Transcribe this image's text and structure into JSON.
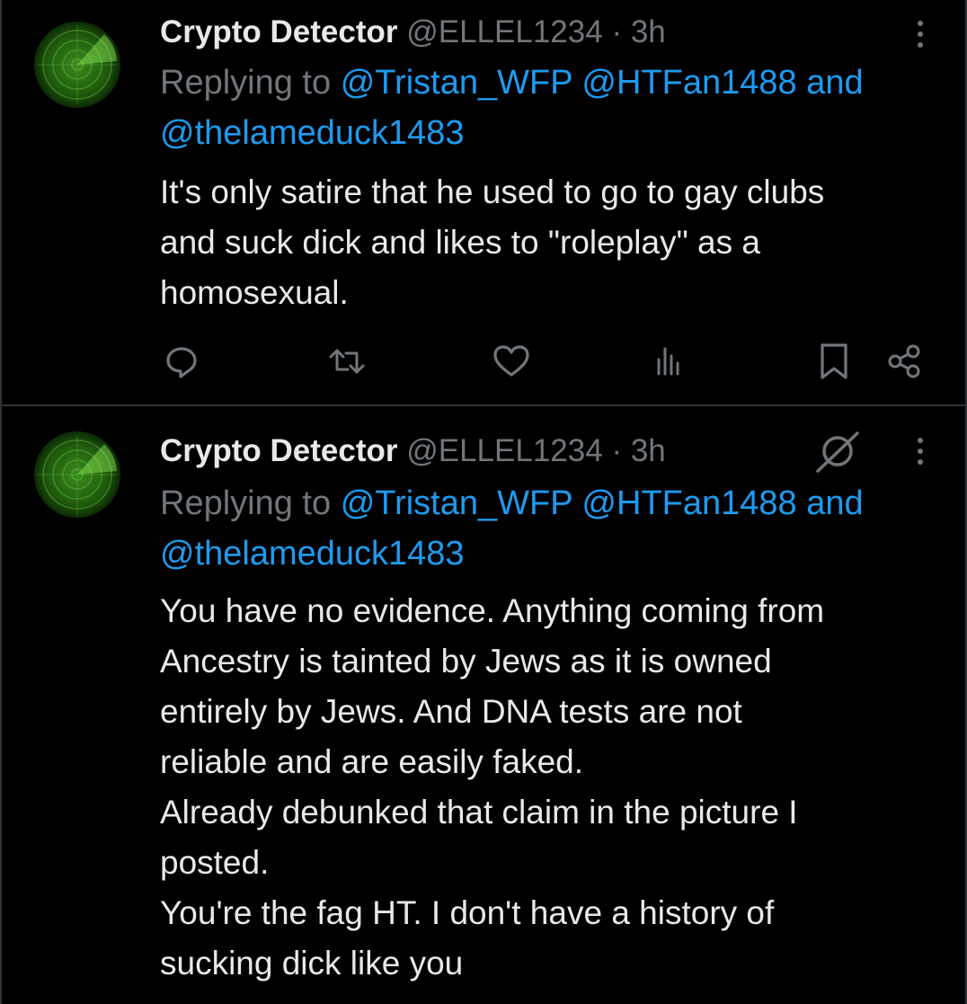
{
  "tweets": [
    {
      "display_name": "Crypto Detector",
      "handle": "@ELLEL1234",
      "separator": "·",
      "time": "3h",
      "replying_prefix": "Replying to",
      "mentions_line1": [
        "@Tristan_WFP",
        "@HTFan1488"
      ],
      "mentions_conjunction": "and",
      "mentions_line2": "@thelameduck1483",
      "body": "It's only satire that he used to go to gay clubs\nand suck dick and likes to \"roleplay\" as a\nhomosexual.",
      "actions": [
        "reply-icon",
        "retweet-icon",
        "like-icon",
        "views-icon",
        "bookmark-icon",
        "share-icon"
      ]
    },
    {
      "display_name": "Crypto Detector",
      "handle": "@ELLEL1234",
      "separator": "·",
      "time": "3h",
      "replying_prefix": "Replying to",
      "mentions_line1": [
        "@Tristan_WFP",
        "@HTFan1488"
      ],
      "mentions_conjunction": "and",
      "mentions_line2": "@thelameduck1483",
      "body": "You have no evidence. Anything coming from\nAncestry is tainted by Jews as it is owned\nentirely by Jews. And DNA tests are not\nreliable and are easily faked.\nAlready debunked that claim in the picture I\nposted.\nYou're the fag HT. I don't have a history of\nsucking dick like you",
      "header_icon": "grok-icon"
    }
  ],
  "colors": {
    "background": "#000000",
    "text": "#e7e9ea",
    "muted": "#71767b",
    "link": "#1d9bf0",
    "divider": "#2f3336"
  }
}
